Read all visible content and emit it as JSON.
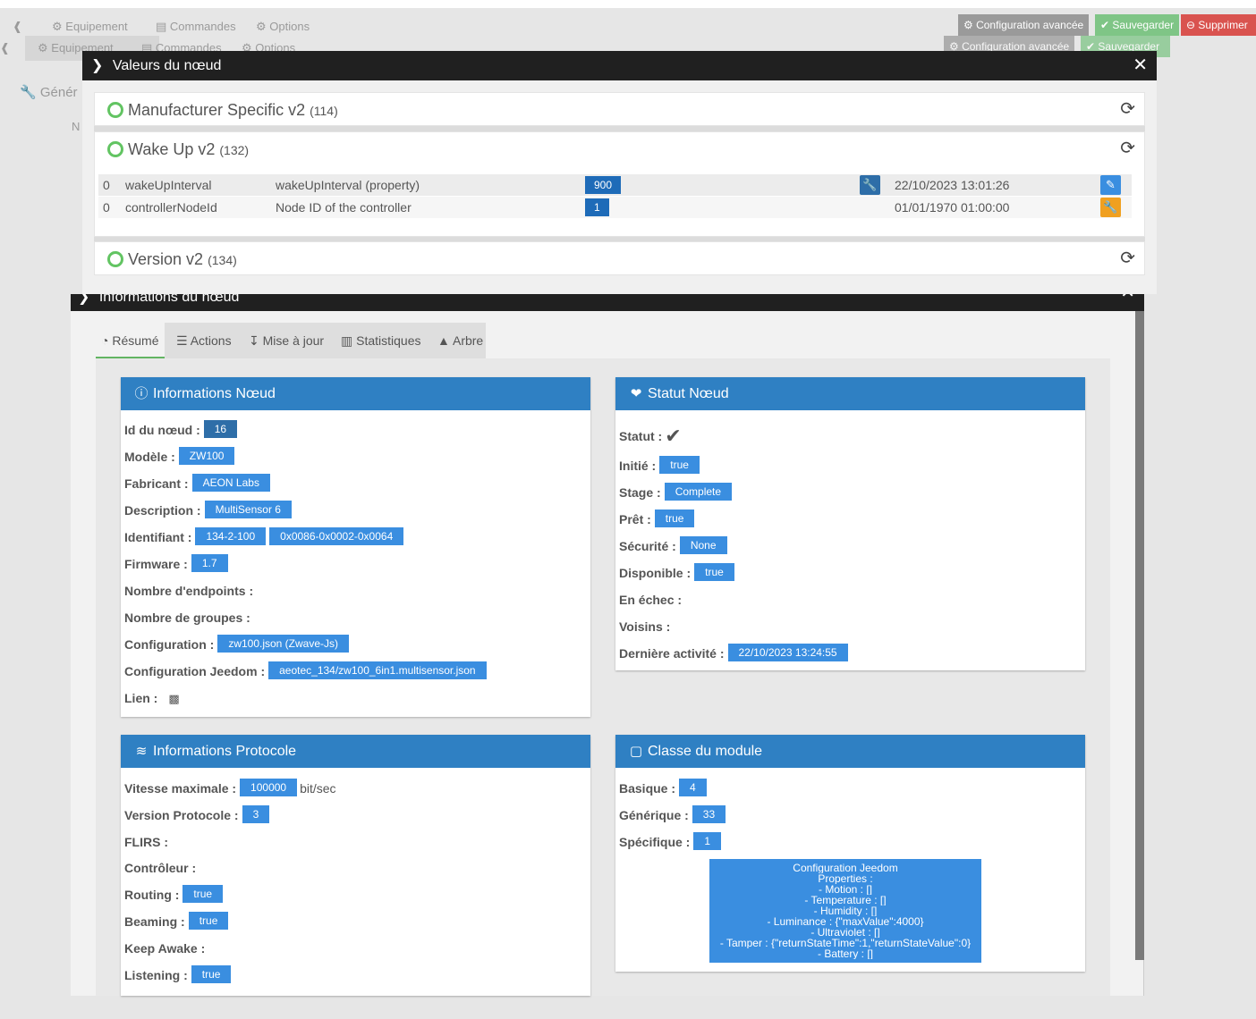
{
  "background": {
    "tabs_row1": [
      "Equipement",
      "Commandes",
      "Options"
    ],
    "tabs_row2": [
      "Equipement",
      "Commandes",
      "Options"
    ],
    "buttons_row1": [
      "Configuration avancée",
      "Sauvegarder",
      "Supprimer"
    ],
    "buttons_row2": [
      "Configuration avancée",
      "Sauvegarder"
    ],
    "left_label": "Génér",
    "left_label2": "N"
  },
  "values_modal": {
    "title": "Valeurs du nœud",
    "classes": [
      {
        "name": "Manufacturer Specific v2",
        "id": "(114)"
      },
      {
        "name": "Wake Up v2",
        "id": "(132)"
      },
      {
        "name": "Version v2",
        "id": "(134)"
      }
    ],
    "rows": [
      {
        "idx": "0",
        "label": "wakeUpInterval",
        "desc": "wakeUpInterval (property)",
        "value": "900",
        "time": "22/10/2023 13:01:26"
      },
      {
        "idx": "0",
        "label": "controllerNodeId",
        "desc": "Node ID of the controller",
        "value": "1",
        "time": "01/01/1970 01:00:00"
      }
    ]
  },
  "info_modal": {
    "title": "Informations du nœud",
    "tabs": [
      "Résumé",
      "Actions",
      "Mise à jour",
      "Statistiques",
      "Arbre"
    ]
  },
  "node_info": {
    "title": "Informations Nœud",
    "id_label": "Id du nœud :",
    "id_value": "16",
    "model_label": "Modèle :",
    "model_value": "ZW100",
    "maker_label": "Fabricant :",
    "maker_value": "AEON Labs",
    "desc_label": "Description :",
    "desc_value": "MultiSensor 6",
    "ident_label": "Identifiant :",
    "ident_value1": "134-2-100",
    "ident_value2": "0x0086-0x0002-0x0064",
    "fw_label": "Firmware :",
    "fw_value": "1.7",
    "endpoints_label": "Nombre d'endpoints :",
    "groups_label": "Nombre de groupes :",
    "config_label": "Configuration :",
    "config_value": "zw100.json (Zwave-Js)",
    "jconfig_label": "Configuration Jeedom :",
    "jconfig_value": "aeotec_134/zw100_6in1.multisensor.json",
    "link_label": "Lien :"
  },
  "node_status": {
    "title": "Statut Nœud",
    "status_label": "Statut :",
    "init_label": "Initié :",
    "init_value": "true",
    "stage_label": "Stage :",
    "stage_value": "Complete",
    "ready_label": "Prêt :",
    "ready_value": "true",
    "security_label": "Sécurité :",
    "security_value": "None",
    "available_label": "Disponible :",
    "available_value": "true",
    "failed_label": "En échec :",
    "neighbors_label": "Voisins :",
    "last_label": "Dernière activité :",
    "last_value": "22/10/2023 13:24:55"
  },
  "protocol": {
    "title": "Informations Protocole",
    "speed_label": "Vitesse maximale :",
    "speed_value": "100000",
    "speed_unit": "bit/sec",
    "version_label": "Version Protocole :",
    "version_value": "3",
    "flirs_label": "FLIRS :",
    "controller_label": "Contrôleur :",
    "routing_label": "Routing :",
    "routing_value": "true",
    "beaming_label": "Beaming :",
    "beaming_value": "true",
    "keepawake_label": "Keep Awake :",
    "listening_label": "Listening :",
    "listening_value": "true"
  },
  "module_class": {
    "title": "Classe du module",
    "basic_label": "Basique :",
    "basic_value": "4",
    "generic_label": "Générique :",
    "generic_value": "33",
    "specific_label": "Spécifique :",
    "specific_value": "1",
    "config_lines": [
      "Configuration Jeedom",
      "Properties :",
      "- Motion : []",
      "- Temperature : []",
      "- Humidity : []",
      "- Luminance : {\"maxValue\":4000}",
      "- Ultraviolet : []",
      "- Tamper : {\"returnStateTime\":1,\"returnStateValue\":0}",
      "- Battery : []"
    ]
  },
  "colors": {
    "panel_header": "#2f80c3",
    "badge": "#3a8ee0",
    "badge_dark": "#2e6ea8",
    "ok_green": "#62c462",
    "modal_title_bg": "#202020"
  }
}
